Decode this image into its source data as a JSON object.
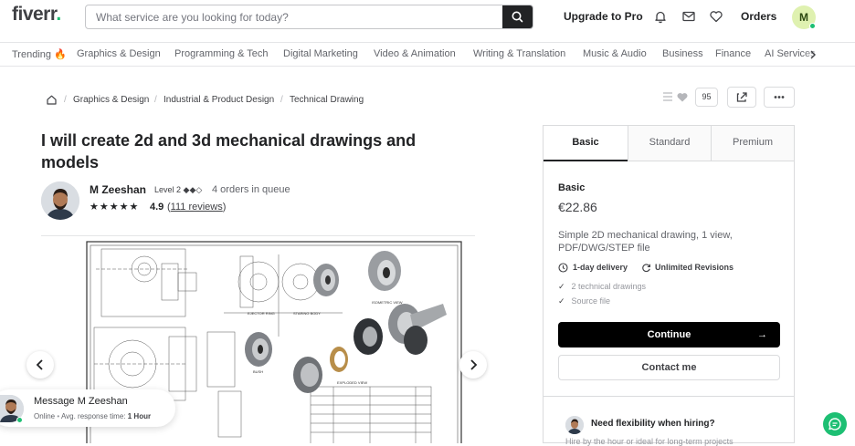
{
  "header": {
    "logo_text": "fiverr",
    "logo_dot": ".",
    "search_placeholder": "What service are you looking for today?",
    "upgrade_label": "Upgrade to Pro",
    "orders_label": "Orders",
    "avatar_initial": "M",
    "icons": [
      "bell-icon",
      "mail-icon",
      "heart-icon"
    ],
    "brand_green": "#1dbf73"
  },
  "categories": [
    "Trending 🔥",
    "Graphics & Design",
    "Programming & Tech",
    "Digital Marketing",
    "Video & Animation",
    "Writing & Translation",
    "Music & Audio",
    "Business",
    "Finance",
    "AI Services"
  ],
  "breadcrumb": [
    "Graphics & Design",
    "Industrial & Product Design",
    "Technical Drawing"
  ],
  "actions": {
    "like_count": "95"
  },
  "gig": {
    "title": "I will create 2d and 3d mechanical drawings and models",
    "seller_name": "M Zeeshan",
    "seller_level": "Level 2 ◆◆◇",
    "queue": "4 orders in queue",
    "stars": "★★★★★",
    "rating": "4.9",
    "reviews_open": "(",
    "reviews_link": "111 reviews",
    "reviews_close": ")"
  },
  "message": {
    "title": "Message M Zeeshan",
    "status": "Online",
    "response_label": "Avg. response time:",
    "response_value": "1 Hour"
  },
  "package": {
    "tabs": [
      "Basic",
      "Standard",
      "Premium"
    ],
    "active_tab": "Basic",
    "name": "Basic",
    "price": "€22.86",
    "description": "Simple 2D mechanical drawing, 1 view, PDF/DWG/STEP file",
    "delivery": "1-day delivery",
    "revisions": "Unlimited Revisions",
    "features": [
      "2 technical drawings",
      "Source file"
    ],
    "continue_label": "Continue",
    "continue_arrow": "→",
    "contact_label": "Contact me",
    "flex_title": "Need flexibility when hiring?",
    "flex_sub": "Hire by the hour or ideal for long-term projects"
  }
}
